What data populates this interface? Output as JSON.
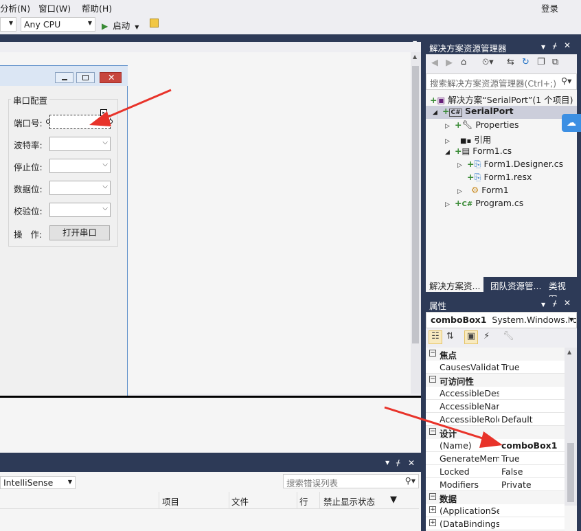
{
  "menubar": {
    "items": [
      "分析(N)",
      "窗口(W)",
      "帮助(H)"
    ],
    "login": "登录"
  },
  "toolbar": {
    "platform": "Any CPU",
    "start_label": "启动"
  },
  "form": {
    "group_title": "串口配置",
    "fields": [
      {
        "label": "端口号:"
      },
      {
        "label": "波特率:"
      },
      {
        "label": "停止位:"
      },
      {
        "label": "数据位:"
      },
      {
        "label": "校验位:"
      }
    ],
    "action_label": "操   作:",
    "open_button": "打开串口"
  },
  "error_list": {
    "filter": "IntelliSense",
    "search_placeholder": "搜索错误列表",
    "columns": [
      "项目",
      "文件",
      "行",
      "禁止显示状态"
    ]
  },
  "solution_explorer": {
    "title": "解决方案资源管理器",
    "search_placeholder": "搜索解决方案资源管理器(Ctrl+;)",
    "tree": [
      {
        "label": "解决方案“SerialPort”(1 个项目)"
      },
      {
        "label": "SerialPort"
      },
      {
        "label": "Properties"
      },
      {
        "label": "引用"
      },
      {
        "label": "Form1.cs"
      },
      {
        "label": "Form1.Designer.cs"
      },
      {
        "label": "Form1.resx"
      },
      {
        "label": "Form1"
      },
      {
        "label": "Program.cs"
      }
    ],
    "tabs": [
      "解决方案资...",
      "团队资源管...",
      "类视图"
    ]
  },
  "properties": {
    "title": "属性",
    "object_name": "comboBox1",
    "object_type": "System.Windows.For",
    "categories": [
      {
        "name": "焦点",
        "rows": [
          {
            "name": "CausesValidati",
            "value": "True"
          }
        ]
      },
      {
        "name": "可访问性",
        "rows": [
          {
            "name": "AccessibleDesc",
            "value": ""
          },
          {
            "name": "AccessibleNam",
            "value": ""
          },
          {
            "name": "AccessibleRole",
            "value": "Default"
          }
        ]
      },
      {
        "name": "设计",
        "rows": [
          {
            "name": "(Name)",
            "value": "comboBox1"
          },
          {
            "name": "GenerateMeml",
            "value": "True"
          },
          {
            "name": "Locked",
            "value": "False"
          },
          {
            "name": "Modifiers",
            "value": "Private"
          }
        ]
      },
      {
        "name": "数据",
        "rows": [
          {
            "name": "(ApplicationSet",
            "value": ""
          },
          {
            "name": "(DataBindings)",
            "value": ""
          }
        ]
      }
    ]
  },
  "colors": {
    "accent_dark": "#2d3a57",
    "tab_highlight": "#f4df90",
    "annotation_arrow": "#e8332a"
  }
}
